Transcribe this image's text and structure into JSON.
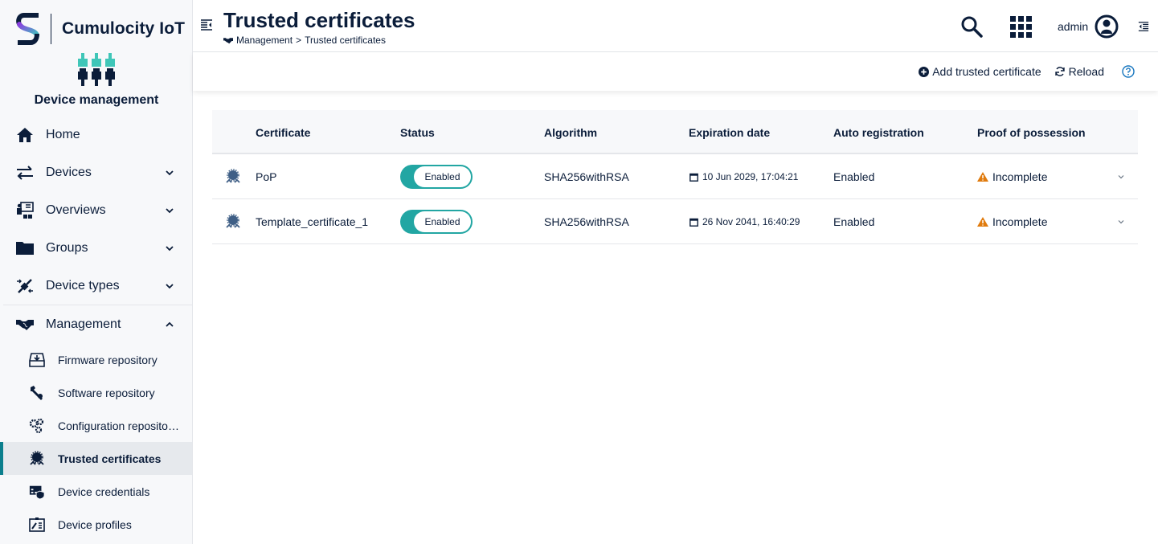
{
  "brand": {
    "name": "Cumulocity IoT",
    "app_name": "Device management"
  },
  "sidebar": {
    "items": [
      {
        "label": "Home",
        "icon": "home-icon",
        "expandable": false
      },
      {
        "label": "Devices",
        "icon": "arrows-exchange-icon",
        "expandable": true
      },
      {
        "label": "Overviews",
        "icon": "presentation-icon",
        "expandable": true
      },
      {
        "label": "Groups",
        "icon": "folder-icon",
        "expandable": true
      },
      {
        "label": "Device types",
        "icon": "plug-icon",
        "expandable": true
      },
      {
        "label": "Management",
        "icon": "handshake-icon",
        "expandable": true,
        "expanded": true
      }
    ],
    "sub_items": [
      {
        "label": "Firmware repository",
        "icon": "firmware-download-icon"
      },
      {
        "label": "Software repository",
        "icon": "wrench-icon"
      },
      {
        "label": "Configuration reposito…",
        "icon": "gears-icon"
      },
      {
        "label": "Trusted certificates",
        "icon": "certificate-icon",
        "active": true
      },
      {
        "label": "Device credentials",
        "icon": "credentials-shield-icon"
      },
      {
        "label": "Device profiles",
        "icon": "profile-icon"
      }
    ]
  },
  "header": {
    "title": "Trusted certificates",
    "breadcrumb": {
      "parent": "Management",
      "separator": ">",
      "current": "Trusted certificates"
    },
    "user": "admin"
  },
  "actions": {
    "add": "Add trusted certificate",
    "reload": "Reload"
  },
  "table": {
    "columns": [
      "Certificate",
      "Status",
      "Algorithm",
      "Expiration date",
      "Auto registration",
      "Proof of possession"
    ],
    "rows": [
      {
        "certificate": "PoP",
        "status": "Enabled",
        "algorithm": "SHA256withRSA",
        "expiration": "10 Jun 2029, 17:04:21",
        "auto_registration": "Enabled",
        "pop": "Incomplete"
      },
      {
        "certificate": "Template_certificate_1",
        "status": "Enabled",
        "algorithm": "SHA256withRSA",
        "expiration": "26 Nov 2041, 16:40:29",
        "auto_registration": "Enabled",
        "pop": "Incomplete"
      }
    ]
  },
  "colors": {
    "primary": "#0b1d3a",
    "accent": "#22a6a3",
    "active_bar": "#0b7f8d",
    "warning": "#e07b0e",
    "help": "#1776bf"
  }
}
